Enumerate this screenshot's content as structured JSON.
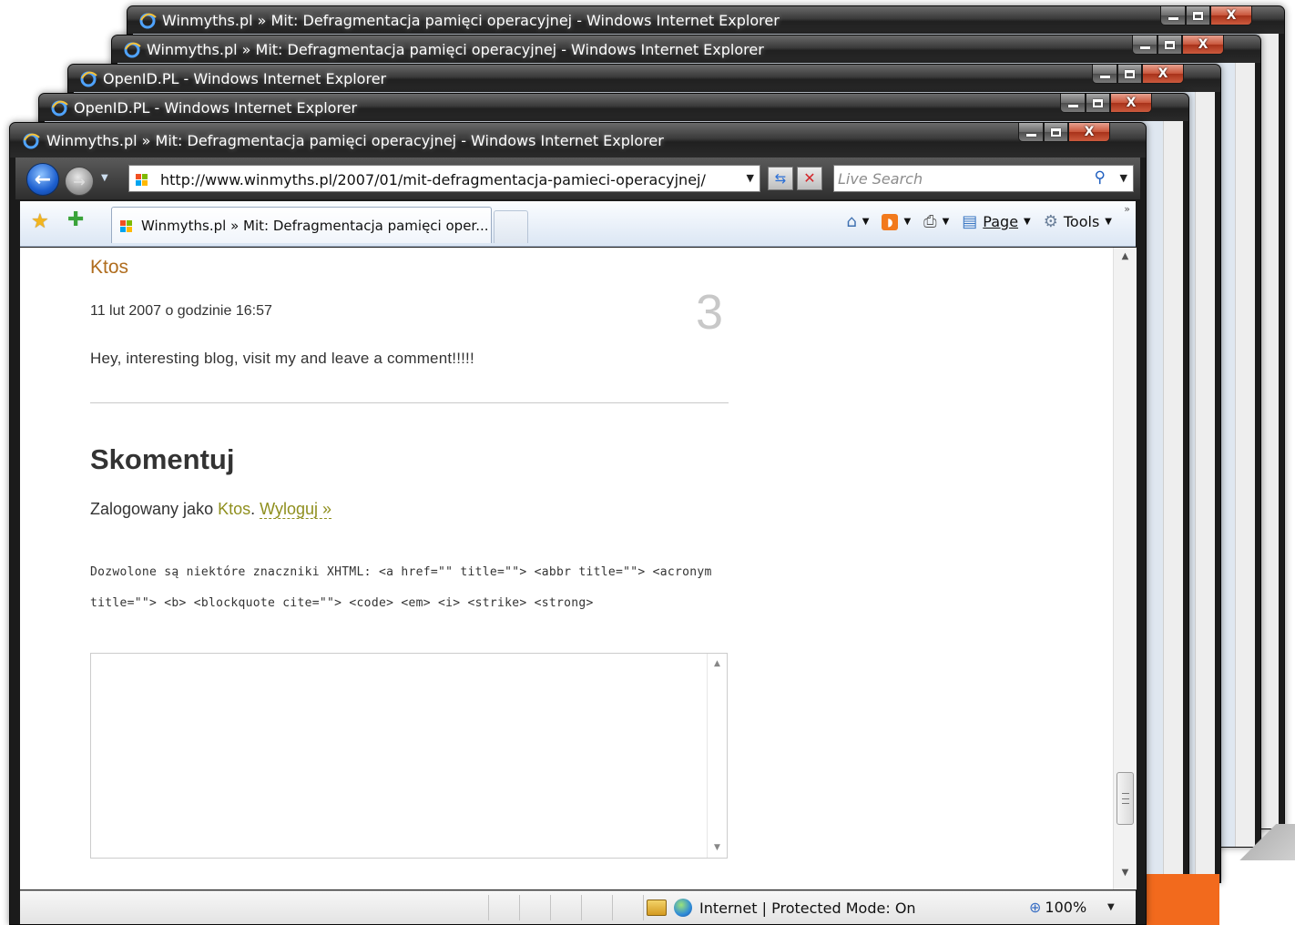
{
  "background_windows": [
    {
      "title": "Winmyths.pl » Mit: Defragmentacja pamięci operacyjnej - Windows Internet Explorer"
    },
    {
      "title": "Winmyths.pl » Mit: Defragmentacja pamięci operacyjnej - Windows Internet Explorer"
    },
    {
      "title": "OpenID.PL - Windows Internet Explorer"
    },
    {
      "title": "OpenID.PL - Windows Internet Explorer"
    }
  ],
  "window": {
    "title": "Winmyths.pl » Mit: Defragmentacja pamięci operacyjnej - Windows Internet Explorer",
    "caption_buttons": {
      "minimize": "–",
      "maximize": "□",
      "close": "X"
    }
  },
  "navigation": {
    "back_glyph": "←",
    "forward_glyph": "→",
    "url": "http://www.winmyths.pl/2007/01/mit-defragmentacja-pamieci-operacyjnej/",
    "search_placeholder": "Live Search"
  },
  "tab": {
    "label": "Winmyths.pl » Mit: Defragmentacja pamięci oper..."
  },
  "toolbar": {
    "page_label": "Page",
    "tools_label": "Tools"
  },
  "comment": {
    "author": "Ktos",
    "date": "11 lut 2007 o godzinie 16:57",
    "number": "3",
    "text": "Hey, interesting blog, visit my and leave a comment!!!!!"
  },
  "reply": {
    "heading": "Skomentuj",
    "logged_prefix": "Zalogowany jako ",
    "user": "Ktos",
    "separator": ". ",
    "logout": "Wyloguj »",
    "allowed_tags": "Dozwolone są niektóre znaczniki XHTML: <a href=\"\" title=\"\"> <abbr title=\"\"> <acronym title=\"\"> <b> <blockquote cite=\"\"> <code> <em> <i> <strike> <strong>"
  },
  "status": {
    "zone": "Internet | Protected Mode: On",
    "zoom": "100%"
  },
  "colors": {
    "author_link": "#b06d1e",
    "user_link": "#8f8f1e",
    "titlebar_dark": "#202020",
    "close_button": "#c8553a"
  },
  "icons": [
    "ie-icon",
    "back-icon",
    "forward-icon",
    "refresh-icon",
    "stop-icon",
    "search-icon",
    "favorites-star-icon",
    "add-favorites-icon",
    "home-icon",
    "feed-icon",
    "print-icon",
    "page-icon",
    "gear-icon",
    "lock-icon",
    "globe-icon",
    "zoom-icon"
  ]
}
